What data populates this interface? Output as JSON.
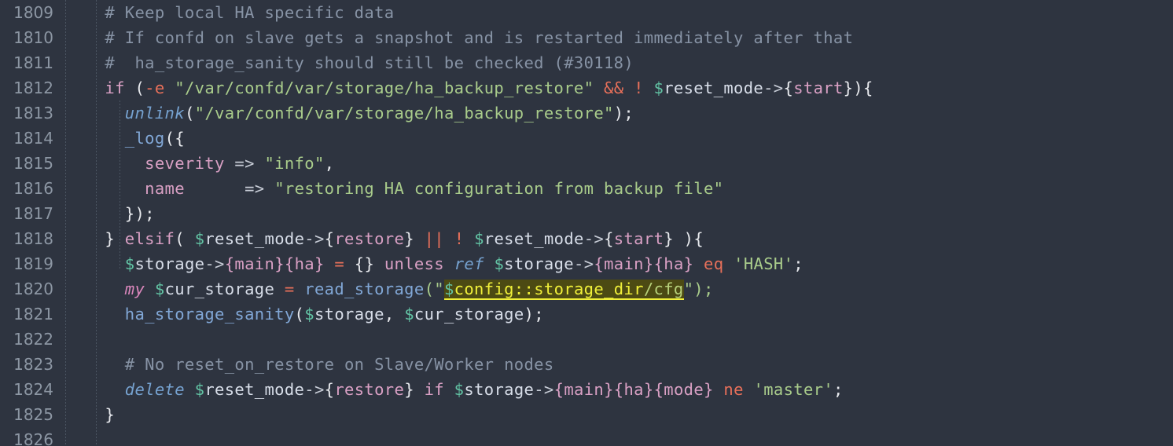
{
  "editor": {
    "theme_name": "dark-nord",
    "background": "#2e3440",
    "gutter_background": "#2e3440",
    "line_number_color": "#8c96a3",
    "highlight_background": "#4c4a13",
    "highlight_foreground": "#f0f03a",
    "language": "perl",
    "first_visible_line": 1809,
    "last_visible_line": 1826,
    "search_match": "$config::storage_dir/cfg"
  },
  "line_numbers": [
    "1809",
    "1810",
    "1811",
    "1812",
    "1813",
    "1814",
    "1815",
    "1816",
    "1817",
    "1818",
    "1819",
    "1820",
    "1821",
    "1822",
    "1823",
    "1824",
    "1825",
    "1826"
  ],
  "lines": [
    {
      "number": "1809",
      "text": "  # Keep local HA specific data"
    },
    {
      "number": "1810",
      "text": "  # If confd on slave gets a snapshot and is restarted immediately after that"
    },
    {
      "number": "1811",
      "text": "  #  ha_storage_sanity should still be checked (#30118)"
    },
    {
      "number": "1812",
      "text": "  if (-e \"/var/confd/var/storage/ha_backup_restore\" && ! $reset_mode->{start}){"
    },
    {
      "number": "1813",
      "text": "    unlink(\"/var/confd/var/storage/ha_backup_restore\");"
    },
    {
      "number": "1814",
      "text": "    _log({"
    },
    {
      "number": "1815",
      "text": "      severity => \"info\","
    },
    {
      "number": "1816",
      "text": "      name     => \"restoring HA configuration from backup file\""
    },
    {
      "number": "1817",
      "text": "    });"
    },
    {
      "number": "1818",
      "text": "  } elsif( $reset_mode->{restore} || ! $reset_mode->{start} ){"
    },
    {
      "number": "1819",
      "text": "    $storage->{main}{ha} = {} unless ref $storage->{main}{ha} eq 'HASH';"
    },
    {
      "number": "1820",
      "text": "    my $cur_storage = read_storage(\"$config::storage_dir/cfg\");"
    },
    {
      "number": "1821",
      "text": "    ha_storage_sanity($storage, $cur_storage);"
    },
    {
      "number": "1822",
      "text": ""
    },
    {
      "number": "1823",
      "text": "    # No reset_on_restore on Slave/Worker nodes"
    },
    {
      "number": "1824",
      "text": "    delete $reset_mode->{restore} if $storage->{main}{ha}{mode} ne 'master';"
    },
    {
      "number": "1825",
      "text": "  }"
    },
    {
      "number": "1826",
      "text": ""
    }
  ],
  "tokens": {
    "l1809": {
      "comment": "  # Keep local HA specific data"
    },
    "l1810": {
      "comment": "  # If confd on slave gets a snapshot and is restarted immediately after that"
    },
    "l1811": {
      "comment": "  #  ha_storage_sanity should still be checked (#30118)"
    },
    "l1812": {
      "indent": "  ",
      "keyword": "if",
      "paren_open": " (",
      "filetest": "-e",
      "string": " \"/var/confd/var/storage/ha_backup_restore\"",
      "and_op": " &&",
      "not_op": " !",
      "sigil": " $",
      "var": "reset_mode",
      "arrow": "->",
      "brace_open": "{",
      "key": "start",
      "tail": "}){"
    },
    "l1813": {
      "indent": "    ",
      "func": "unlink",
      "paren_open": "(",
      "string": "\"/var/confd/var/storage/ha_backup_restore\"",
      "tail": ");"
    },
    "l1814": {
      "indent": "    ",
      "func": "_log",
      "tail": "({"
    },
    "l1815": {
      "indent": "      ",
      "key": "severity",
      "fat_arrow": " => ",
      "string": "\"info\"",
      "tail": ","
    },
    "l1816": {
      "indent": "      ",
      "key": "name",
      "pad": "     ",
      "fat_arrow": " => ",
      "string": "\"restoring HA configuration from backup file\""
    },
    "l1817": {
      "indent": "    ",
      "tail": "});"
    },
    "l1818": {
      "indent": "  ",
      "close_brace": "} ",
      "keyword": "elsif",
      "paren_open": "( ",
      "sigil": "$",
      "var": "reset_mode",
      "arrow": "->",
      "brace_open": "{",
      "key": "restore",
      "brace_close": "} ",
      "or_op": "||",
      "not_op": " !",
      "sigil2": " $",
      "var2": "reset_mode",
      "arrow2": "->",
      "brace_open2": "{",
      "key2": "start",
      "tail": "} ){"
    },
    "l1819": {
      "indent": "    ",
      "sigil": "$",
      "var": "storage",
      "arrow": "->",
      "key_main": "{main}",
      "key_ha": "{ha}",
      "assign": " = ",
      "empty_hash": "{}",
      "unless_kw": " unless ",
      "ref_fn": "ref",
      "sigil2": " $",
      "var2": "storage",
      "arrow2": "->",
      "key_main2": "{main}",
      "key_ha2": "{ha}",
      "eq_op": " eq ",
      "string": "'HASH'",
      "tail": ";"
    },
    "l1820": {
      "indent": "    ",
      "my_kw": "my",
      "sigil": " $",
      "var": "cur_storage",
      "assign": " = ",
      "func": "read_storage",
      "paren_quote": "(\"",
      "hl_sigil": "$",
      "hl_text": "config::storage_dir",
      "hl_tail": "/cfg",
      "tail": "\");"
    },
    "l1821": {
      "indent": "    ",
      "func": "ha_storage_sanity",
      "paren_open": "(",
      "sigil": "$",
      "var": "storage",
      "comma": ", ",
      "sigil2": "$",
      "var2": "cur_storage",
      "tail": ");"
    },
    "l1822": {
      "text": ""
    },
    "l1823": {
      "comment": "    # No reset_on_restore on Slave/Worker nodes"
    },
    "l1824": {
      "indent": "    ",
      "delete_kw": "delete",
      "sigil": " $",
      "var": "reset_mode",
      "arrow": "->",
      "brace_open": "{",
      "key": "restore",
      "brace_close": "} ",
      "if_kw": "if",
      "sigil2": " $",
      "var2": "storage",
      "arrow2": "->",
      "key_main": "{main}",
      "key_ha": "{ha}",
      "key_mode": "{mode}",
      "ne_op": " ne ",
      "string": "'master'",
      "tail": ";"
    },
    "l1825": {
      "indent": "  ",
      "brace": "}"
    },
    "l1826": {
      "text": ""
    }
  }
}
